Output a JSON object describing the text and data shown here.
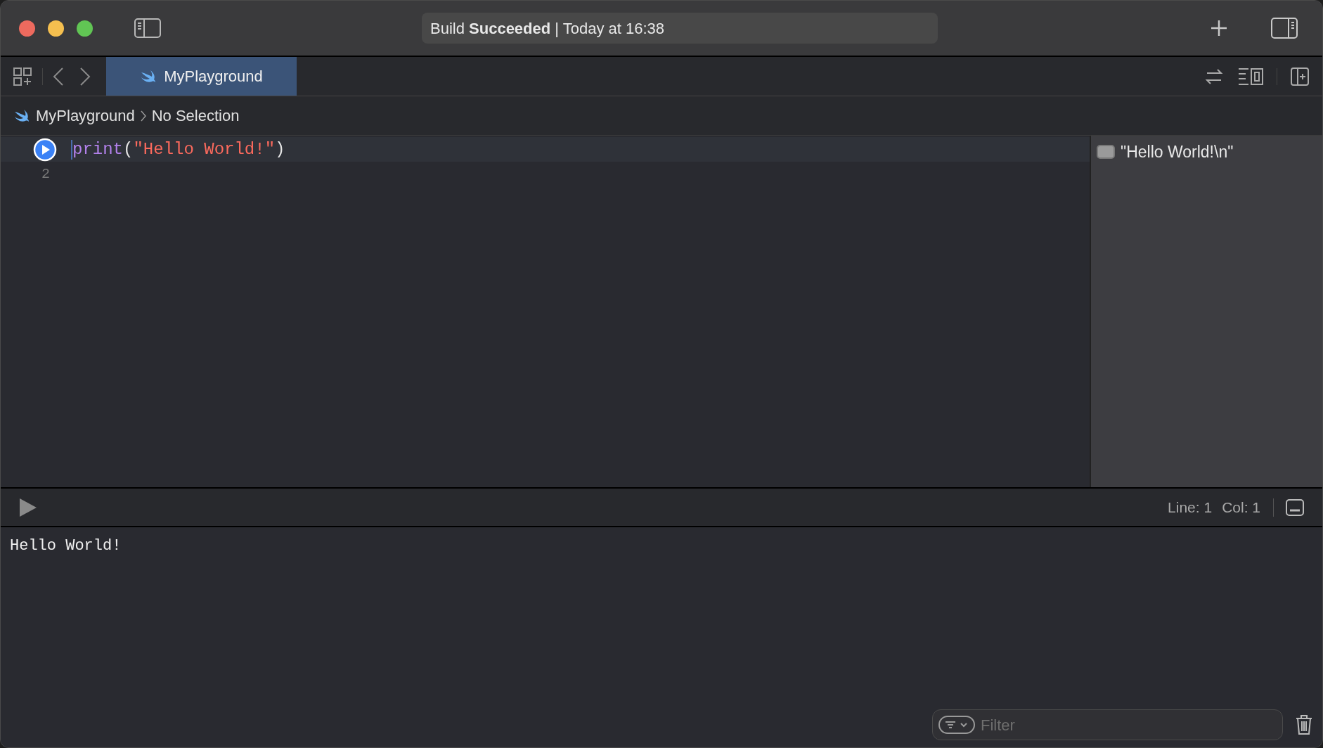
{
  "toolbar": {
    "status": "Build **Succeeded** | Today at 16:38"
  },
  "tabs": [
    {
      "label": "MyPlayground",
      "selected": true
    }
  ],
  "breadcrumb": [
    "MyPlayground",
    "No Selection"
  ],
  "editor": {
    "lines": [
      {
        "kind": "run",
        "selected": true,
        "tokens": [
          {
            "kind": "keyword",
            "text": "print"
          },
          {
            "kind": "plain",
            "text": "("
          },
          {
            "kind": "string",
            "text": "\"Hello World!\""
          },
          {
            "kind": "plain",
            "text": ")"
          }
        ]
      },
      {
        "kind": "number",
        "selected": false,
        "number": "2"
      }
    ]
  },
  "results": [
    "\"Hello World!\\n\""
  ],
  "debug_bar": {
    "line": "Line: 1",
    "col": "Col: 1"
  },
  "console": {
    "output": "Hello World!",
    "filter": {
      "placeholder": "Filter"
    }
  }
}
